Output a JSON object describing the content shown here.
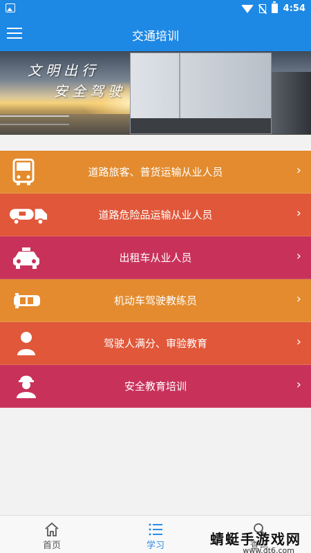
{
  "status_bar": {
    "time": "4:54"
  },
  "app_bar": {
    "title": "交通培训"
  },
  "banner": {
    "line1": "文明出行",
    "line2": "安全驾驶"
  },
  "menu": {
    "items": [
      {
        "label": "道路旅客、普货运输从业人员",
        "icon": "bus-icon",
        "color": "#e38b2e"
      },
      {
        "label": "道路危险品运输从业人员",
        "icon": "tanker-truck-icon",
        "color": "#e0573a"
      },
      {
        "label": "出租车从业人员",
        "icon": "taxi-icon",
        "color": "#c8325a"
      },
      {
        "label": "机动车驾驶教练员",
        "icon": "car-icon",
        "color": "#e38b2e"
      },
      {
        "label": "驾驶人满分、审验教育",
        "icon": "person-icon",
        "color": "#e0573a"
      },
      {
        "label": "安全教育培训",
        "icon": "worker-icon",
        "color": "#c8325a"
      }
    ],
    "chevron": "›"
  },
  "bottom_nav": {
    "items": [
      {
        "label": "首页",
        "icon": "home-icon"
      },
      {
        "label": "学习",
        "icon": "list-icon",
        "active": true
      },
      {
        "label": "查询",
        "icon": "search-icon"
      }
    ]
  },
  "watermark": {
    "title": "蜻蜓手游戏网",
    "url": "www.qt6.com"
  },
  "colors": {
    "primary": "#1e88e5",
    "active_tab": "#2b8be6",
    "orange": "#e38b2e",
    "red_orange": "#e0573a",
    "crimson": "#c8325a"
  }
}
